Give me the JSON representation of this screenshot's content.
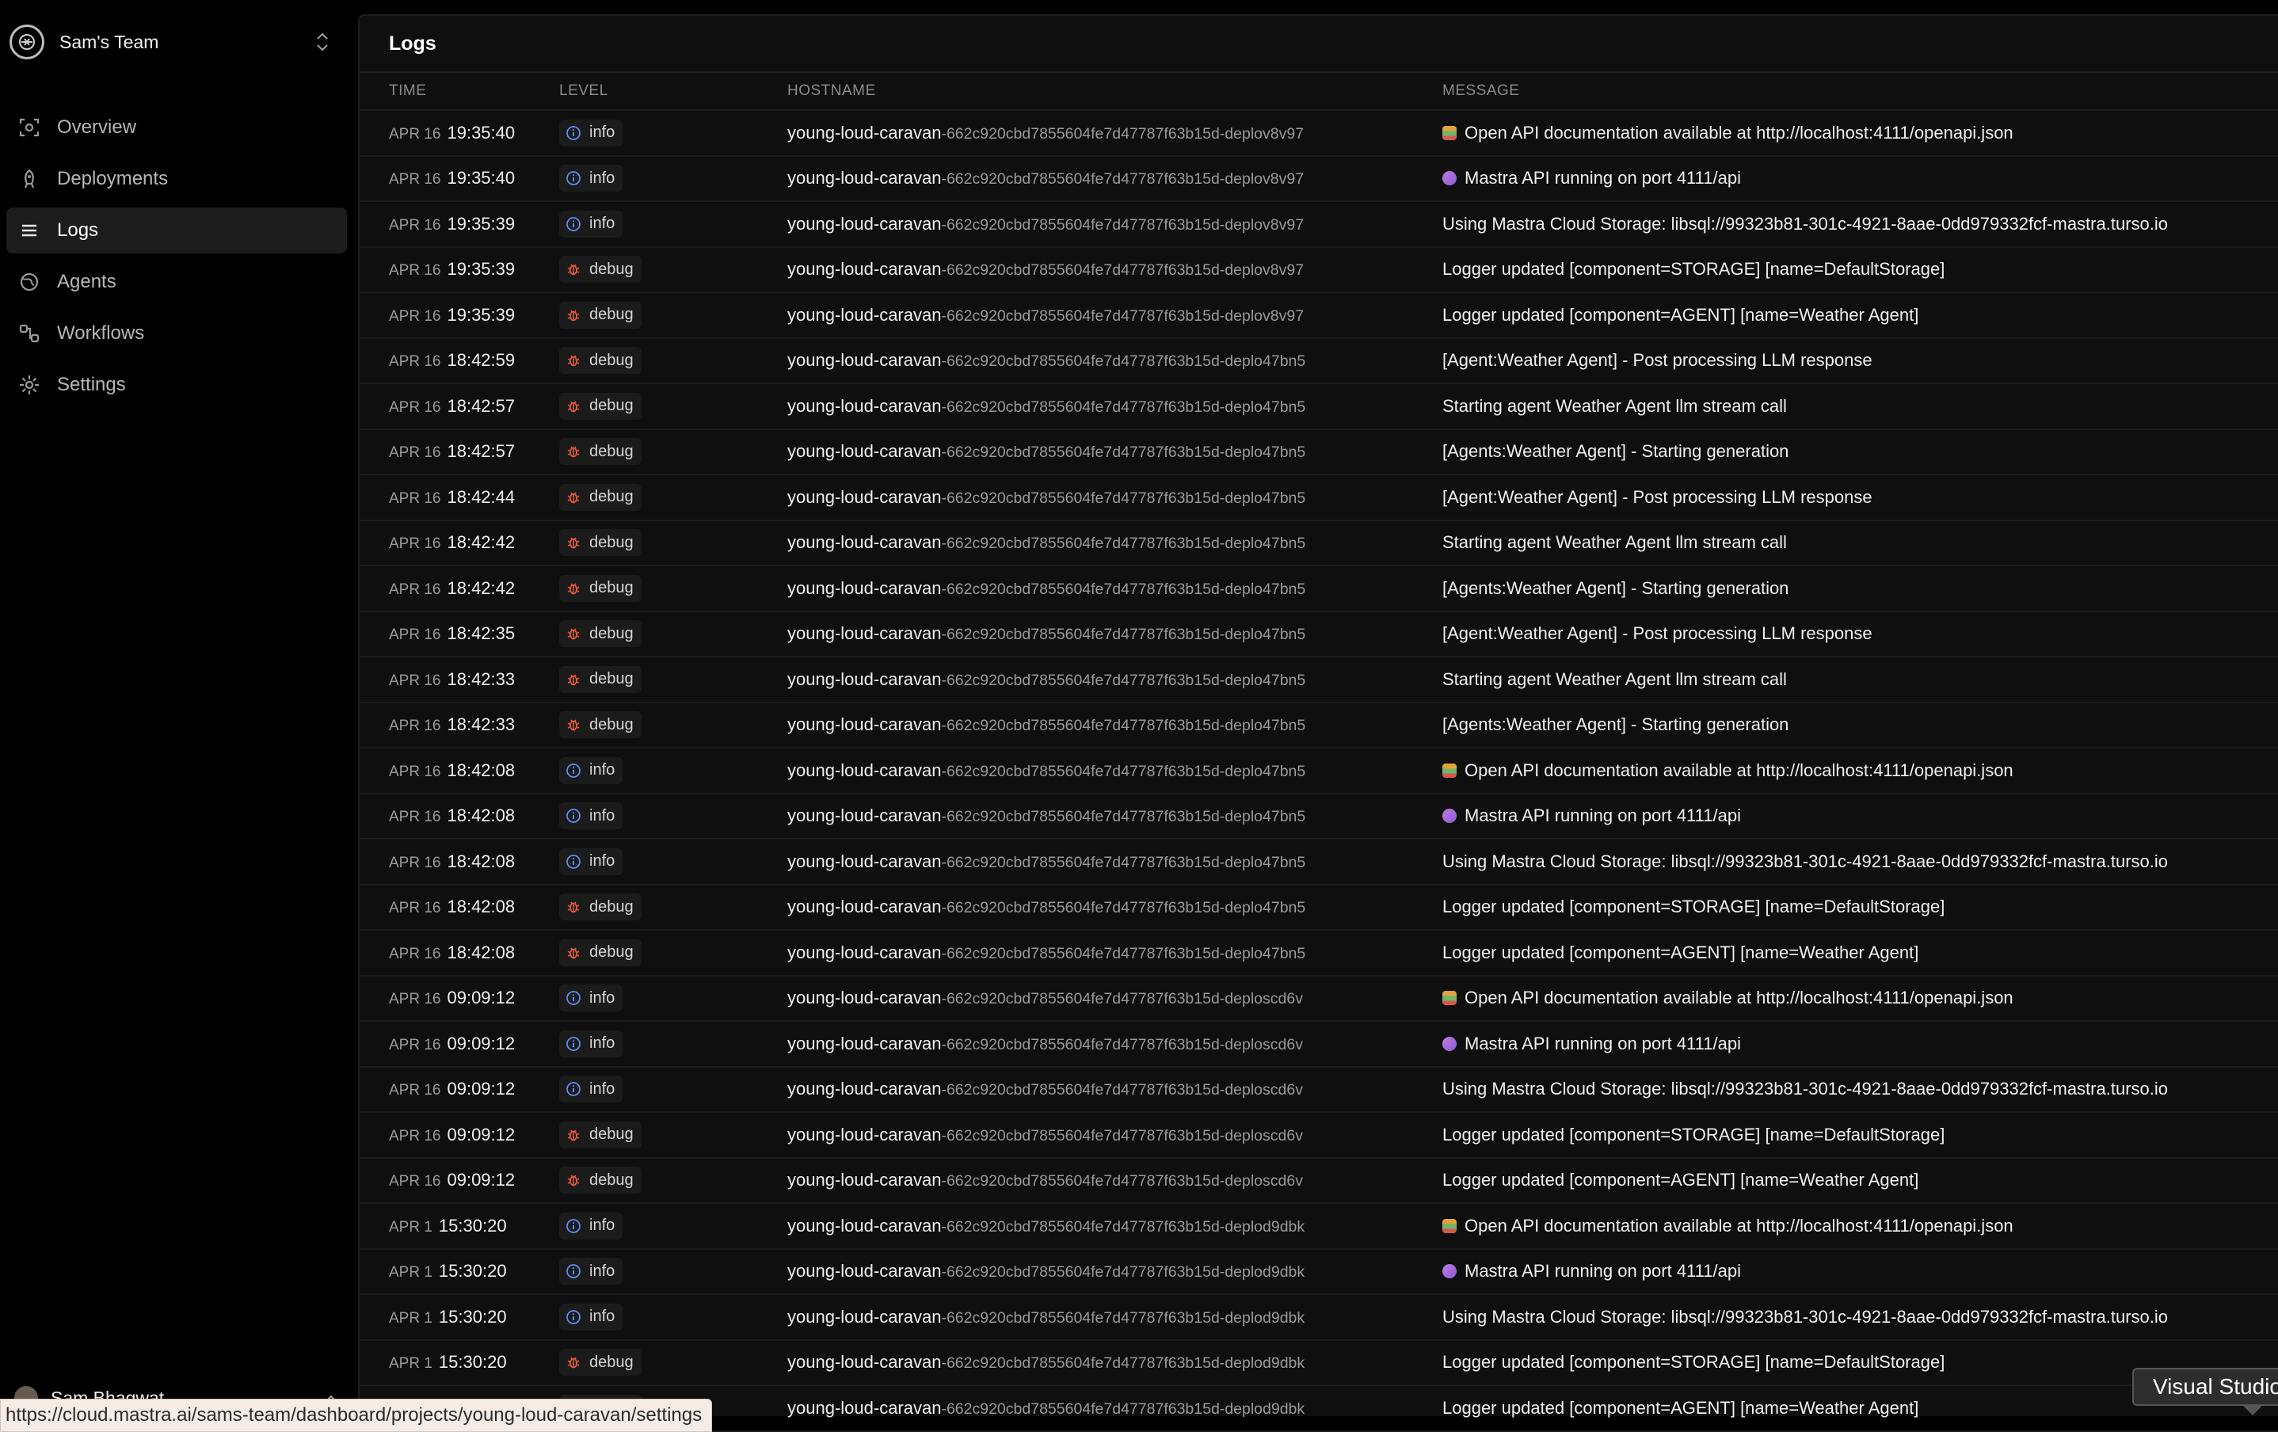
{
  "team": {
    "name": "Sam's Team"
  },
  "nav": [
    {
      "label": "Overview",
      "icon": "overview-icon",
      "active": false
    },
    {
      "label": "Deployments",
      "icon": "rocket-icon",
      "active": false
    },
    {
      "label": "Logs",
      "icon": "list-icon",
      "active": true
    },
    {
      "label": "Agents",
      "icon": "globe-icon",
      "active": false
    },
    {
      "label": "Workflows",
      "icon": "workflow-icon",
      "active": false
    },
    {
      "label": "Settings",
      "icon": "gear-icon",
      "active": false
    }
  ],
  "user": {
    "name": "Sam Bhagwat"
  },
  "page": {
    "title": "Logs"
  },
  "columns": {
    "time": "TIME",
    "level": "LEVEL",
    "hostname": "HOSTNAME",
    "message": "MESSAGE"
  },
  "colors": {
    "info": "#5b8def",
    "debug": "#e0583a",
    "background": "#0f0f0f"
  },
  "logs": [
    {
      "date": "APR 16",
      "time": "19:35:40",
      "level": "info",
      "host": "young-loud-caravan",
      "host_id": "-662c920cbd7855604fe7d47787f63b15d-deplov8v97",
      "emoji": "book",
      "message": "Open API documentation available at http://localhost:4111/openapi.json"
    },
    {
      "date": "APR 16",
      "time": "19:35:40",
      "level": "info",
      "host": "young-loud-caravan",
      "host_id": "-662c920cbd7855604fe7d47787f63b15d-deplov8v97",
      "emoji": "rocket",
      "message": "Mastra API running on port 4111/api"
    },
    {
      "date": "APR 16",
      "time": "19:35:39",
      "level": "info",
      "host": "young-loud-caravan",
      "host_id": "-662c920cbd7855604fe7d47787f63b15d-deplov8v97",
      "emoji": "",
      "message": "Using Mastra Cloud Storage: libsql://99323b81-301c-4921-8aae-0dd979332fcf-mastra.turso.io"
    },
    {
      "date": "APR 16",
      "time": "19:35:39",
      "level": "debug",
      "host": "young-loud-caravan",
      "host_id": "-662c920cbd7855604fe7d47787f63b15d-deplov8v97",
      "emoji": "",
      "message": "Logger updated [component=STORAGE] [name=DefaultStorage]"
    },
    {
      "date": "APR 16",
      "time": "19:35:39",
      "level": "debug",
      "host": "young-loud-caravan",
      "host_id": "-662c920cbd7855604fe7d47787f63b15d-deplov8v97",
      "emoji": "",
      "message": "Logger updated [component=AGENT] [name=Weather Agent]"
    },
    {
      "date": "APR 16",
      "time": "18:42:59",
      "level": "debug",
      "host": "young-loud-caravan",
      "host_id": "-662c920cbd7855604fe7d47787f63b15d-deplo47bn5",
      "emoji": "",
      "message": "[Agent:Weather Agent] - Post processing LLM response"
    },
    {
      "date": "APR 16",
      "time": "18:42:57",
      "level": "debug",
      "host": "young-loud-caravan",
      "host_id": "-662c920cbd7855604fe7d47787f63b15d-deplo47bn5",
      "emoji": "",
      "message": "Starting agent Weather Agent llm stream call"
    },
    {
      "date": "APR 16",
      "time": "18:42:57",
      "level": "debug",
      "host": "young-loud-caravan",
      "host_id": "-662c920cbd7855604fe7d47787f63b15d-deplo47bn5",
      "emoji": "",
      "message": "[Agents:Weather Agent] - Starting generation"
    },
    {
      "date": "APR 16",
      "time": "18:42:44",
      "level": "debug",
      "host": "young-loud-caravan",
      "host_id": "-662c920cbd7855604fe7d47787f63b15d-deplo47bn5",
      "emoji": "",
      "message": "[Agent:Weather Agent] - Post processing LLM response"
    },
    {
      "date": "APR 16",
      "time": "18:42:42",
      "level": "debug",
      "host": "young-loud-caravan",
      "host_id": "-662c920cbd7855604fe7d47787f63b15d-deplo47bn5",
      "emoji": "",
      "message": "Starting agent Weather Agent llm stream call"
    },
    {
      "date": "APR 16",
      "time": "18:42:42",
      "level": "debug",
      "host": "young-loud-caravan",
      "host_id": "-662c920cbd7855604fe7d47787f63b15d-deplo47bn5",
      "emoji": "",
      "message": "[Agents:Weather Agent] - Starting generation"
    },
    {
      "date": "APR 16",
      "time": "18:42:35",
      "level": "debug",
      "host": "young-loud-caravan",
      "host_id": "-662c920cbd7855604fe7d47787f63b15d-deplo47bn5",
      "emoji": "",
      "message": "[Agent:Weather Agent] - Post processing LLM response"
    },
    {
      "date": "APR 16",
      "time": "18:42:33",
      "level": "debug",
      "host": "young-loud-caravan",
      "host_id": "-662c920cbd7855604fe7d47787f63b15d-deplo47bn5",
      "emoji": "",
      "message": "Starting agent Weather Agent llm stream call"
    },
    {
      "date": "APR 16",
      "time": "18:42:33",
      "level": "debug",
      "host": "young-loud-caravan",
      "host_id": "-662c920cbd7855604fe7d47787f63b15d-deplo47bn5",
      "emoji": "",
      "message": "[Agents:Weather Agent] - Starting generation"
    },
    {
      "date": "APR 16",
      "time": "18:42:08",
      "level": "info",
      "host": "young-loud-caravan",
      "host_id": "-662c920cbd7855604fe7d47787f63b15d-deplo47bn5",
      "emoji": "book",
      "message": "Open API documentation available at http://localhost:4111/openapi.json"
    },
    {
      "date": "APR 16",
      "time": "18:42:08",
      "level": "info",
      "host": "young-loud-caravan",
      "host_id": "-662c920cbd7855604fe7d47787f63b15d-deplo47bn5",
      "emoji": "rocket",
      "message": "Mastra API running on port 4111/api"
    },
    {
      "date": "APR 16",
      "time": "18:42:08",
      "level": "info",
      "host": "young-loud-caravan",
      "host_id": "-662c920cbd7855604fe7d47787f63b15d-deplo47bn5",
      "emoji": "",
      "message": "Using Mastra Cloud Storage: libsql://99323b81-301c-4921-8aae-0dd979332fcf-mastra.turso.io"
    },
    {
      "date": "APR 16",
      "time": "18:42:08",
      "level": "debug",
      "host": "young-loud-caravan",
      "host_id": "-662c920cbd7855604fe7d47787f63b15d-deplo47bn5",
      "emoji": "",
      "message": "Logger updated [component=STORAGE] [name=DefaultStorage]"
    },
    {
      "date": "APR 16",
      "time": "18:42:08",
      "level": "debug",
      "host": "young-loud-caravan",
      "host_id": "-662c920cbd7855604fe7d47787f63b15d-deplo47bn5",
      "emoji": "",
      "message": "Logger updated [component=AGENT] [name=Weather Agent]"
    },
    {
      "date": "APR 16",
      "time": "09:09:12",
      "level": "info",
      "host": "young-loud-caravan",
      "host_id": "-662c920cbd7855604fe7d47787f63b15d-deploscd6v",
      "emoji": "book",
      "message": "Open API documentation available at http://localhost:4111/openapi.json"
    },
    {
      "date": "APR 16",
      "time": "09:09:12",
      "level": "info",
      "host": "young-loud-caravan",
      "host_id": "-662c920cbd7855604fe7d47787f63b15d-deploscd6v",
      "emoji": "rocket",
      "message": "Mastra API running on port 4111/api"
    },
    {
      "date": "APR 16",
      "time": "09:09:12",
      "level": "info",
      "host": "young-loud-caravan",
      "host_id": "-662c920cbd7855604fe7d47787f63b15d-deploscd6v",
      "emoji": "",
      "message": "Using Mastra Cloud Storage: libsql://99323b81-301c-4921-8aae-0dd979332fcf-mastra.turso.io"
    },
    {
      "date": "APR 16",
      "time": "09:09:12",
      "level": "debug",
      "host": "young-loud-caravan",
      "host_id": "-662c920cbd7855604fe7d47787f63b15d-deploscd6v",
      "emoji": "",
      "message": "Logger updated [component=STORAGE] [name=DefaultStorage]"
    },
    {
      "date": "APR 16",
      "time": "09:09:12",
      "level": "debug",
      "host": "young-loud-caravan",
      "host_id": "-662c920cbd7855604fe7d47787f63b15d-deploscd6v",
      "emoji": "",
      "message": "Logger updated [component=AGENT] [name=Weather Agent]"
    },
    {
      "date": "APR 1",
      "time": "15:30:20",
      "level": "info",
      "host": "young-loud-caravan",
      "host_id": "-662c920cbd7855604fe7d47787f63b15d-deplod9dbk",
      "emoji": "book",
      "message": "Open API documentation available at http://localhost:4111/openapi.json"
    },
    {
      "date": "APR 1",
      "time": "15:30:20",
      "level": "info",
      "host": "young-loud-caravan",
      "host_id": "-662c920cbd7855604fe7d47787f63b15d-deplod9dbk",
      "emoji": "rocket",
      "message": "Mastra API running on port 4111/api"
    },
    {
      "date": "APR 1",
      "time": "15:30:20",
      "level": "info",
      "host": "young-loud-caravan",
      "host_id": "-662c920cbd7855604fe7d47787f63b15d-deplod9dbk",
      "emoji": "",
      "message": "Using Mastra Cloud Storage: libsql://99323b81-301c-4921-8aae-0dd979332fcf-mastra.turso.io"
    },
    {
      "date": "APR 1",
      "time": "15:30:20",
      "level": "debug",
      "host": "young-loud-caravan",
      "host_id": "-662c920cbd7855604fe7d47787f63b15d-deplod9dbk",
      "emoji": "",
      "message": "Logger updated [component=STORAGE] [name=DefaultStorage]"
    },
    {
      "date": "APR 1",
      "time": "15:30:20",
      "level": "debug",
      "host": "young-loud-caravan",
      "host_id": "-662c920cbd7855604fe7d47787f63b15d-deplod9dbk",
      "emoji": "",
      "message": "Logger updated [component=AGENT] [name=Weather Agent]"
    }
  ],
  "status_bar": {
    "url": "https://cloud.mastra.ai/sams-team/dashboard/projects/young-loud-caravan/settings"
  },
  "tooltip": {
    "text": "Visual Studio"
  }
}
